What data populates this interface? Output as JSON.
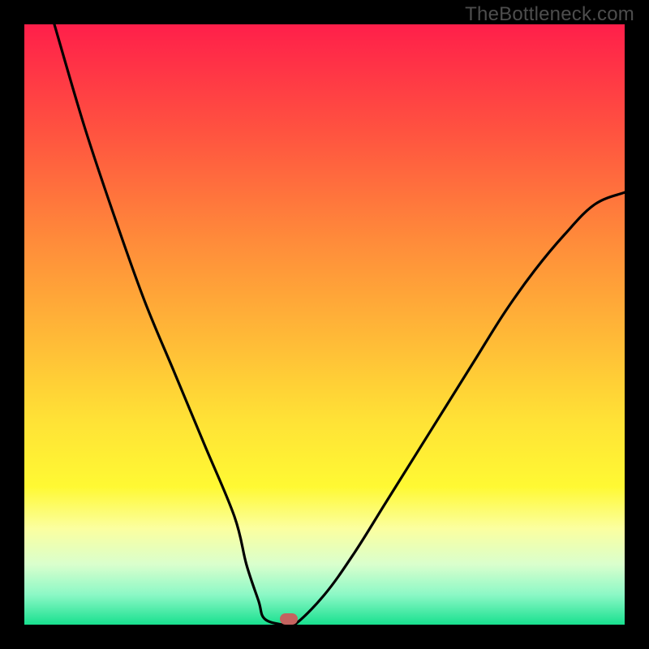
{
  "watermark": "TheBottleneck.com",
  "chart_data": {
    "type": "line",
    "title": "",
    "xlabel": "",
    "ylabel": "",
    "xlim": [
      0,
      100
    ],
    "ylim": [
      0,
      100
    ],
    "series": [
      {
        "name": "curve",
        "x": [
          5,
          10,
          15,
          20,
          25,
          30,
          35,
          37,
          39,
          40,
          43,
          45,
          50,
          55,
          60,
          65,
          70,
          75,
          80,
          85,
          90,
          95,
          100
        ],
        "values": [
          100,
          83,
          68,
          54,
          42,
          30,
          18,
          10,
          4,
          1,
          0,
          0,
          5,
          12,
          20,
          28,
          36,
          44,
          52,
          59,
          65,
          70,
          72
        ]
      }
    ],
    "marker": {
      "x": 44,
      "y": 1
    },
    "gradient_stops": [
      {
        "pct": 0,
        "color": "#ff1f4a"
      },
      {
        "pct": 18,
        "color": "#ff5340"
      },
      {
        "pct": 36,
        "color": "#ff8b3a"
      },
      {
        "pct": 52,
        "color": "#ffb937"
      },
      {
        "pct": 66,
        "color": "#ffe236"
      },
      {
        "pct": 77,
        "color": "#fff933"
      },
      {
        "pct": 84,
        "color": "#fbffa0"
      },
      {
        "pct": 90,
        "color": "#d9ffcd"
      },
      {
        "pct": 95,
        "color": "#8cf8c6"
      },
      {
        "pct": 100,
        "color": "#18e08f"
      }
    ]
  }
}
